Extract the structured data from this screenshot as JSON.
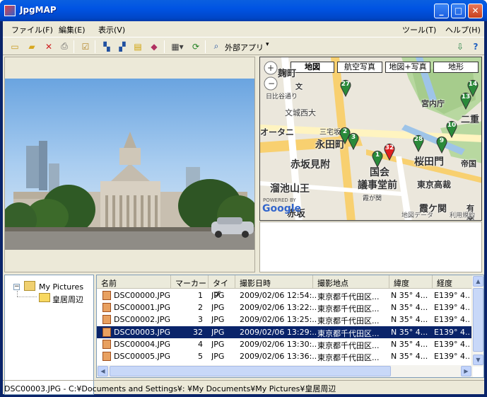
{
  "window": {
    "title": "JpgMAP"
  },
  "menu": {
    "file": "ファイル(F)",
    "edit": "編集(E)",
    "view": "表示(V)",
    "tools": "ツール(T)",
    "help": "ヘルプ(H)"
  },
  "toolbar": {
    "external_apps": "外部アプリ"
  },
  "map": {
    "tabs": [
      "地図",
      "航空写真",
      "地図+写真",
      "地形"
    ],
    "labels": [
      "麹町",
      "文",
      "宮内庁",
      "文城西大",
      "オータニ",
      "三宅坂",
      "永田町",
      "赤坂見附",
      "国会",
      "議事堂前",
      "桜田門",
      "溜池山王",
      "東京高裁",
      "霞ケ関",
      "二重",
      "帝国",
      "有楽",
      "赤坂",
      "霞が関",
      "地図データ",
      "日比谷通り",
      "利用規約"
    ],
    "markers": [
      "27",
      "2",
      "3",
      "1",
      "32",
      "28",
      "9",
      "10",
      "13",
      "14"
    ],
    "logo": "Google",
    "powered": "POWERED BY"
  },
  "tree": {
    "root": "My Pictures",
    "child": "皇居周辺"
  },
  "table": {
    "columns": [
      "名前",
      "マーカー",
      "タイプ",
      "撮影日時",
      "撮影地点",
      "緯度",
      "経度"
    ],
    "rows": [
      [
        "DSC00000.JPG",
        "1",
        "JPG",
        "2009/02/06 12:54:...",
        "東京都千代田区...",
        "N 35° 4...",
        "E139° 4..."
      ],
      [
        "DSC00001.JPG",
        "2",
        "JPG",
        "2009/02/06 13:22:...",
        "東京都千代田区...",
        "N 35° 4...",
        "E139° 4..."
      ],
      [
        "DSC00002.JPG",
        "3",
        "JPG",
        "2009/02/06 13:25:...",
        "東京都千代田区...",
        "N 35° 4...",
        "E139° 4..."
      ],
      [
        "DSC00003.JPG",
        "32",
        "JPG",
        "2009/02/06 13:29:...",
        "東京都千代田区...",
        "N 35° 4...",
        "E139° 4..."
      ],
      [
        "DSC00004.JPG",
        "4",
        "JPG",
        "2009/02/06 13:30:...",
        "東京都千代田区...",
        "N 35° 4...",
        "E139° 4..."
      ],
      [
        "DSC00005.JPG",
        "5",
        "JPG",
        "2009/02/06 13:36:...",
        "東京都千代田区...",
        "N 35° 4...",
        "E139° 4..."
      ]
    ],
    "selected_index": 3
  },
  "status": {
    "path": "DSC00003.JPG - C:¥Documents and Settings¥:      ¥My Documents¥My Pictures¥皇居周辺"
  }
}
